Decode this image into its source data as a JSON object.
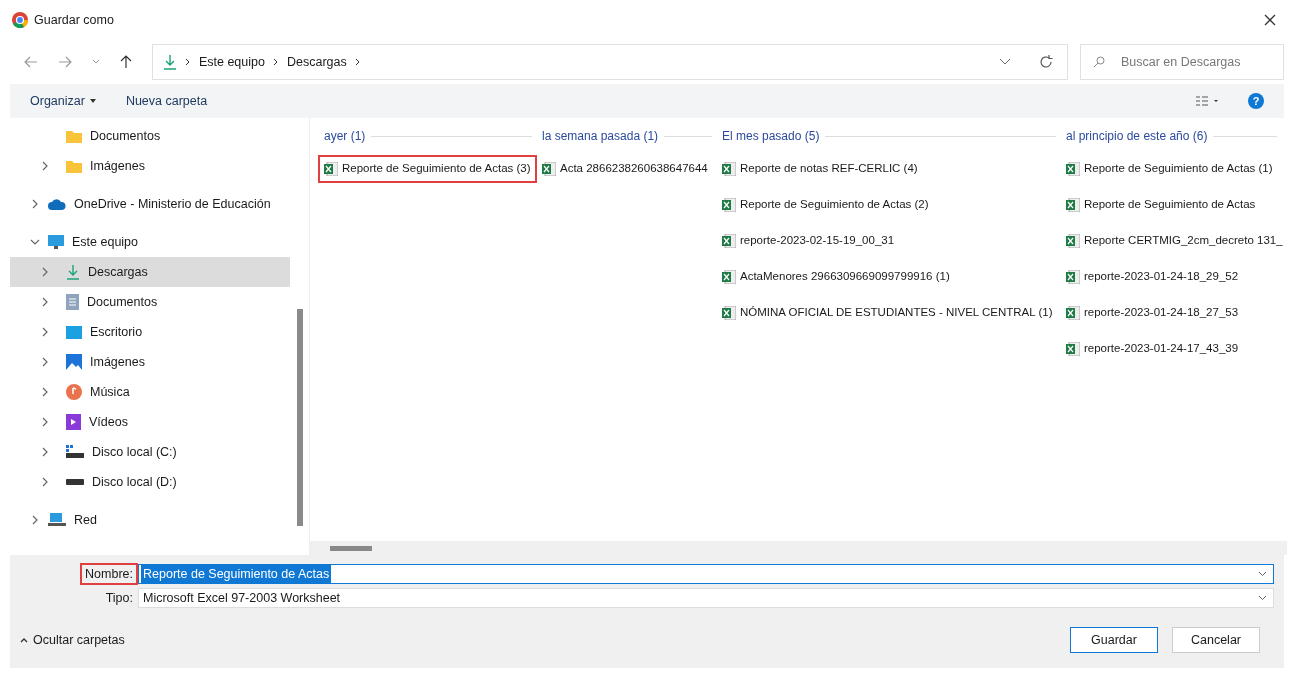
{
  "window": {
    "title": "Guardar como"
  },
  "address_bar": {
    "path": [
      "Este equipo",
      "Descargas"
    ]
  },
  "search": {
    "placeholder": "Buscar en Descargas"
  },
  "toolbar": {
    "buttons": [
      "Organizar",
      "Nueva carpeta"
    ],
    "help": "?"
  },
  "sidebar": {
    "items": [
      {
        "label": "Documentos",
        "kind": "folder",
        "expandable": false,
        "expanded": false,
        "selected": false
      },
      {
        "label": "Imágenes",
        "kind": "folder",
        "expandable": true,
        "expanded": false,
        "selected": false
      },
      {
        "label": "OneDrive - Ministerio de Educación",
        "kind": "cloud",
        "expandable": true,
        "expanded": false,
        "selected": false
      },
      {
        "label": "Este equipo",
        "kind": "pc",
        "expandable": true,
        "expanded": true,
        "selected": false,
        "children": [
          {
            "label": "Descargas",
            "kind": "download",
            "expandable": true,
            "expanded": false,
            "selected": true
          },
          {
            "label": "Documentos",
            "kind": "doc",
            "expandable": true,
            "expanded": false,
            "selected": false
          },
          {
            "label": "Escritorio",
            "kind": "desktop",
            "expandable": true,
            "expanded": false,
            "selected": false
          },
          {
            "label": "Imágenes",
            "kind": "pictures",
            "expandable": true,
            "expanded": false,
            "selected": false
          },
          {
            "label": "Música",
            "kind": "music",
            "expandable": true,
            "expanded": false,
            "selected": false
          },
          {
            "label": "Vídeos",
            "kind": "video",
            "expandable": true,
            "expanded": false,
            "selected": false
          },
          {
            "label": "Disco local (C:)",
            "kind": "drive-c",
            "expandable": true,
            "expanded": false,
            "selected": false
          },
          {
            "label": "Disco local (D:)",
            "kind": "drive",
            "expandable": true,
            "expanded": false,
            "selected": false
          }
        ]
      },
      {
        "label": "Red",
        "kind": "network",
        "expandable": true,
        "expanded": false,
        "selected": false
      }
    ]
  },
  "groups": [
    {
      "title": "ayer (1)",
      "files": [
        {
          "name": "Reporte de Seguimiento de Actas (3)",
          "highlighted": true
        }
      ]
    },
    {
      "title": "la semana pasada (1)",
      "files": [
        {
          "name": "Acta 2866238260638647644",
          "highlighted": false
        }
      ]
    },
    {
      "title": "El mes pasado (5)",
      "files": [
        {
          "name": "Reporte de notas REF-CERLIC (4)",
          "highlighted": false
        },
        {
          "name": "Reporte de Seguimiento de Actas (2)",
          "highlighted": false
        },
        {
          "name": "reporte-2023-02-15-19_00_31",
          "highlighted": false
        },
        {
          "name": "ActaMenores 2966309669099799916 (1)",
          "highlighted": false
        },
        {
          "name": "NÓMINA OFICIAL DE ESTUDIANTES - NIVEL CENTRAL (1)",
          "highlighted": false
        }
      ]
    },
    {
      "title": "al principio de este año (6)",
      "files": [
        {
          "name": "Reporte de Seguimiento de Actas (1)",
          "highlighted": false
        },
        {
          "name": "Reporte de Seguimiento de Actas",
          "highlighted": false
        },
        {
          "name": "Reporte CERTMIG_2cm_decreto 131_",
          "highlighted": false
        },
        {
          "name": "reporte-2023-01-24-18_29_52",
          "highlighted": false
        },
        {
          "name": "reporte-2023-01-24-18_27_53",
          "highlighted": false
        },
        {
          "name": "reporte-2023-01-24-17_43_39",
          "highlighted": false
        }
      ]
    }
  ],
  "fields": [
    {
      "label": "Nombre:",
      "value": "Reporte de Seguimiento de Actas",
      "highlighted": true
    },
    {
      "label": "Tipo:",
      "value": "Microsoft Excel 97-2003 Worksheet",
      "highlighted": false
    }
  ],
  "footer": {
    "toggle": "Ocultar carpetas",
    "buttons": [
      "Guardar",
      "Cancelar"
    ]
  }
}
